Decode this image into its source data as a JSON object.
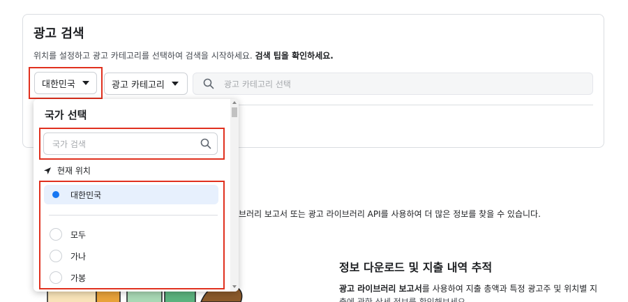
{
  "header": {
    "title": "광고 검색",
    "description": "위치를 설정하고 광고 카테고리를 선택하여 검색을 시작하세요.",
    "tip_link": "검색 팁을 확인하세요."
  },
  "filters": {
    "country_label": "대한민국",
    "category_label": "광고 카테고리",
    "search_placeholder": "광고 카테고리 선택"
  },
  "dropdown": {
    "title": "국가 선택",
    "search_placeholder": "국가 검색",
    "current_location_label": "현재 위치",
    "selected_option": "대한민국",
    "options": [
      "모두",
      "가나",
      "가봉"
    ]
  },
  "background": {
    "info_text": "브러리 보고서 또는 광고 라이브러리 API를 사용하여 더 많은 정보를 찾을 수 있습니다.",
    "section_heading": "정보 다운로드 및 지출 내역 추적",
    "para_bold": "광고 라이브러리 보고서",
    "para_rest": "를 사용하여 지출 총액과 특정 광고주 및 위치별 지",
    "para_line2": "출에 관한 상세 정보를 확인해보세요"
  },
  "colors": {
    "accent": "#1877f2",
    "highlight": "#e0301e",
    "selected_bg": "#e7f0fd"
  }
}
